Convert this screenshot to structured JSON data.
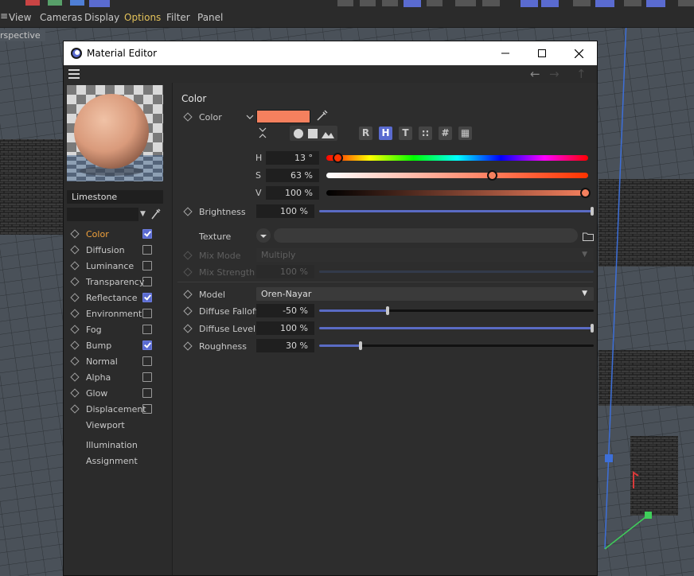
{
  "app": {
    "menu": [
      {
        "label": "View",
        "active": false
      },
      {
        "label": "Cameras",
        "active": false
      },
      {
        "label": "Display",
        "active": false
      },
      {
        "label": "Options",
        "active": true
      },
      {
        "label": "Filter",
        "active": false
      },
      {
        "label": "Panel",
        "active": false
      }
    ],
    "viewport_label": "rspective"
  },
  "window": {
    "title": "Material Editor",
    "icon": "cinema4d-logo-icon"
  },
  "material": {
    "name": "Limestone",
    "preview_color": "#dba283",
    "channels": [
      {
        "label": "Color",
        "has_check": true,
        "checked": true,
        "active": true
      },
      {
        "label": "Diffusion",
        "has_check": true,
        "checked": false,
        "active": false
      },
      {
        "label": "Luminance",
        "has_check": true,
        "checked": false,
        "active": false
      },
      {
        "label": "Transparency",
        "has_check": true,
        "checked": false,
        "active": false
      },
      {
        "label": "Reflectance",
        "has_check": true,
        "checked": true,
        "active": false
      },
      {
        "label": "Environment",
        "has_check": true,
        "checked": false,
        "active": false
      },
      {
        "label": "Fog",
        "has_check": true,
        "checked": false,
        "active": false
      },
      {
        "label": "Bump",
        "has_check": true,
        "checked": true,
        "active": false
      },
      {
        "label": "Normal",
        "has_check": true,
        "checked": false,
        "active": false
      },
      {
        "label": "Alpha",
        "has_check": true,
        "checked": false,
        "active": false
      },
      {
        "label": "Glow",
        "has_check": true,
        "checked": false,
        "active": false
      },
      {
        "label": "Displacement",
        "has_check": true,
        "checked": false,
        "active": false
      },
      {
        "label": "Viewport",
        "has_check": false,
        "checked": false,
        "active": false
      },
      {
        "label": "Illumination",
        "has_check": false,
        "checked": false,
        "active": false
      },
      {
        "label": "Assignment",
        "has_check": false,
        "checked": false,
        "active": false
      }
    ]
  },
  "color_section": {
    "title": "Color",
    "color_label": "Color",
    "swatch": "#f5805e",
    "modes": [
      "R",
      "H",
      "T",
      "::",
      "#",
      "▦"
    ],
    "active_mode": "H",
    "hsv": [
      {
        "label": "H",
        "value": "13 °",
        "fraction": 0.04
      },
      {
        "label": "S",
        "value": "63 %",
        "fraction": 0.63
      },
      {
        "label": "V",
        "value": "100 %",
        "fraction": 1.0
      }
    ],
    "brightness": {
      "label": "Brightness",
      "value": "100 %",
      "fraction": 1.0
    },
    "texture": {
      "label": "Texture"
    },
    "mix_mode": {
      "label": "Mix Mode",
      "value": "Multiply"
    },
    "mix_strength": {
      "label": "Mix Strength",
      "value": "100 %"
    },
    "model": {
      "label": "Model",
      "value": "Oren-Nayar"
    },
    "diffuse_falloff": {
      "label": "Diffuse Falloff",
      "value": "-50 %",
      "fraction": 0.25
    },
    "diffuse_level": {
      "label": "Diffuse Level",
      "value": "100 %",
      "fraction": 1.0
    },
    "roughness": {
      "label": "Roughness",
      "value": "30 %",
      "fraction": 0.15
    }
  },
  "colors": {
    "accent": "#5a6bd0",
    "active_channel": "#f2a23c",
    "menu_active": "#e3c25a"
  }
}
